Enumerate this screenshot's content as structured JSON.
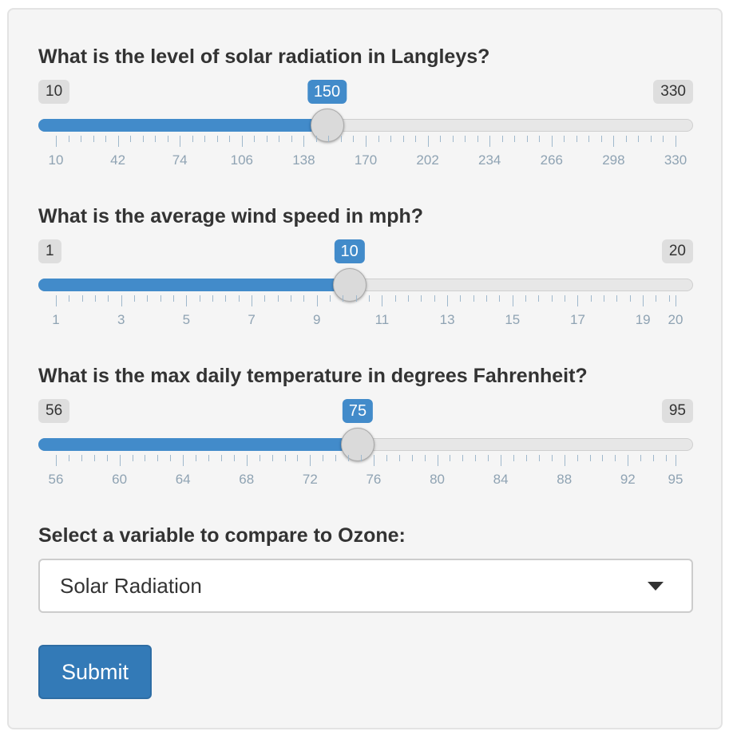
{
  "sliders": [
    {
      "label": "What is the level of solar radiation in Langleys?",
      "min": 10,
      "max": 330,
      "value": 150,
      "min_label": "10",
      "max_label": "330",
      "value_label": "150",
      "ticks": [
        "10",
        "42",
        "74",
        "106",
        "138",
        "170",
        "202",
        "234",
        "266",
        "298",
        "330"
      ]
    },
    {
      "label": "What is the average wind speed in mph?",
      "min": 1,
      "max": 20,
      "value": 10,
      "min_label": "1",
      "max_label": "20",
      "value_label": "10",
      "ticks": [
        "1",
        "3",
        "5",
        "7",
        "9",
        "11",
        "13",
        "15",
        "17",
        "19",
        "20"
      ]
    },
    {
      "label": "What is the max daily temperature in degrees Fahrenheit?",
      "min": 56,
      "max": 95,
      "value": 75,
      "min_label": "56",
      "max_label": "95",
      "value_label": "75",
      "ticks": [
        "56",
        "60",
        "64",
        "68",
        "72",
        "76",
        "80",
        "84",
        "88",
        "92",
        "95"
      ]
    }
  ],
  "select": {
    "label": "Select a variable to compare to Ozone:",
    "value": "Solar Radiation"
  },
  "submit_label": "Submit",
  "colors": {
    "accent": "#428bca",
    "button": "#337ab7",
    "panel": "#f5f5f5"
  }
}
